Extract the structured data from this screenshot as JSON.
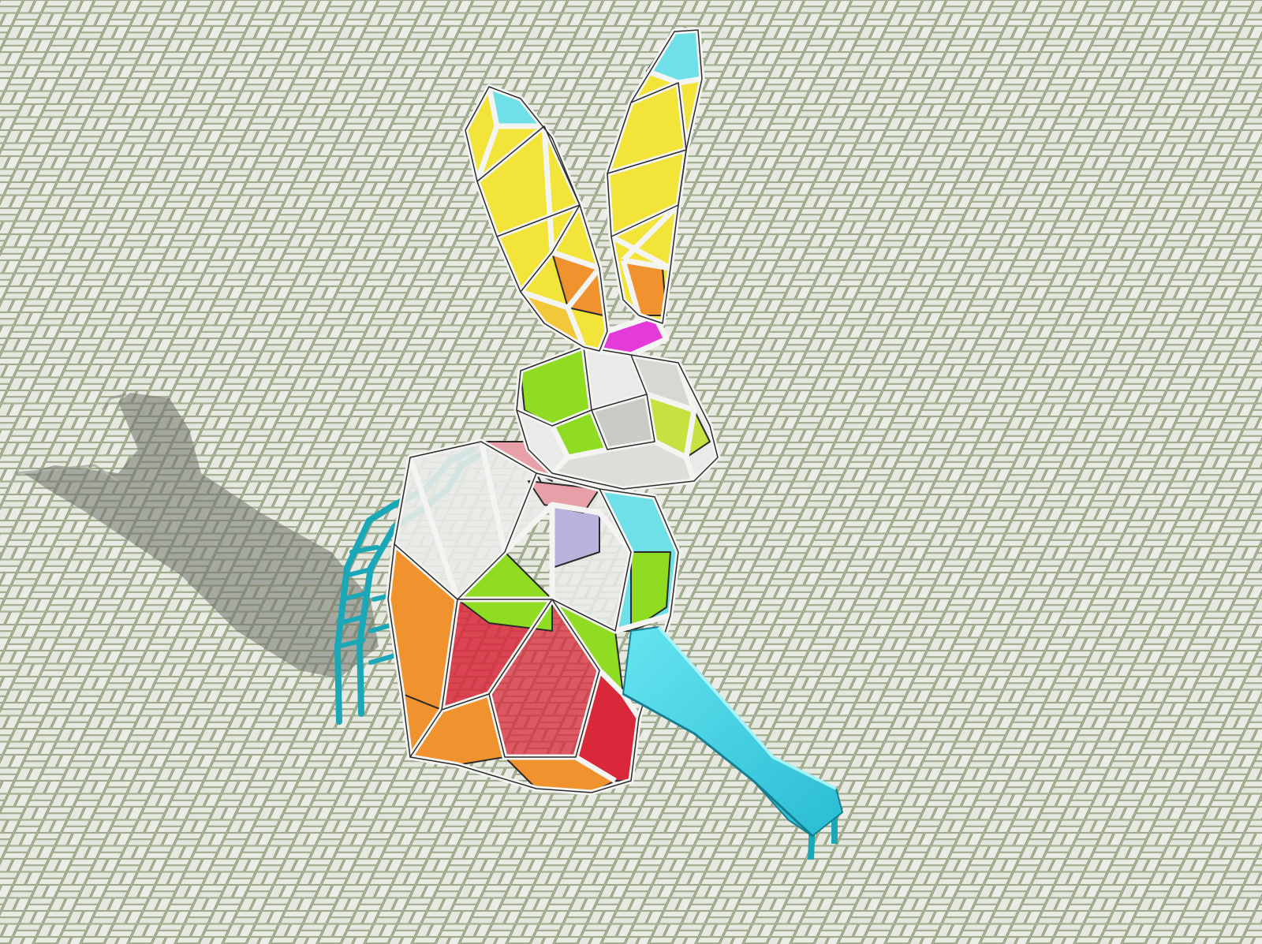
{
  "scene": {
    "subject": "low-poly-rabbit-play-structure",
    "colors": {
      "ground": "#e3e6dc",
      "grout": "#8c9a78",
      "frame": "#f4f4f2",
      "frame_outline": "#2a2a2a",
      "shadow": "#6f7268",
      "slide": "#3fd3e6",
      "yellow": "#f3e43a",
      "orange": "#f0922e",
      "cyan": "#6fe0e8",
      "magenta": "#e43ad8",
      "green": "#8fdc22",
      "red": "#d8283a",
      "pink": "#e8a0a8",
      "lavender": "#b8b4dc",
      "white_panel": "#e9ebe8"
    },
    "icons": [
      "rabbit-sculpture",
      "slide",
      "ladder",
      "shadow"
    ]
  }
}
